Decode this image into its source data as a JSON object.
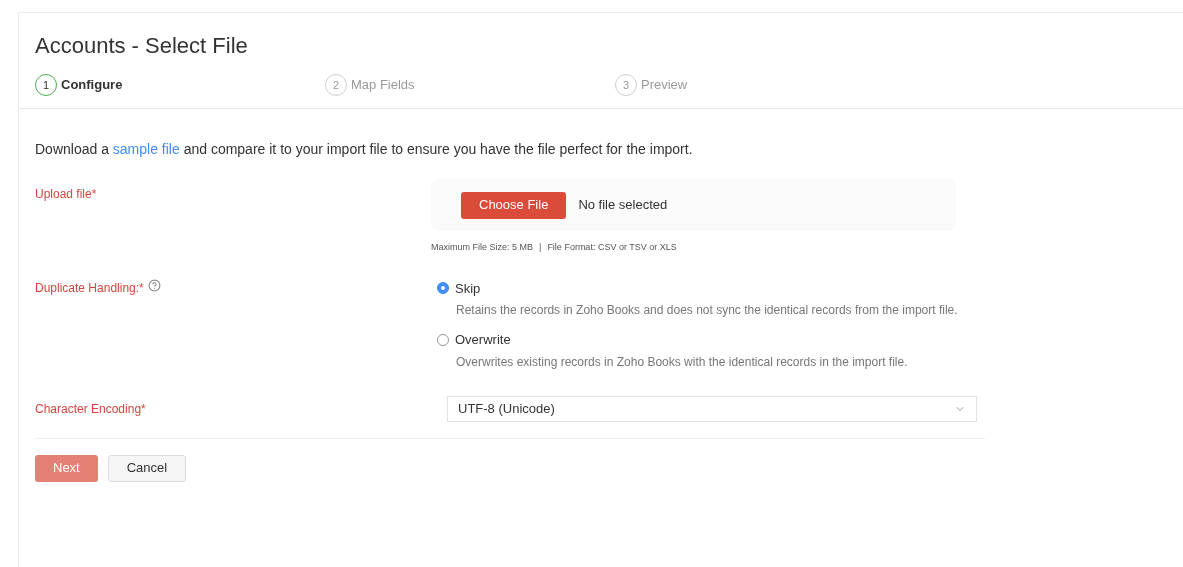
{
  "title": "Accounts - Select File",
  "steps": [
    {
      "number": "1",
      "label": "Configure",
      "selected": true
    },
    {
      "number": "2",
      "label": "Map Fields",
      "selected": false
    },
    {
      "number": "3",
      "label": "Preview",
      "selected": false
    }
  ],
  "intro": {
    "before": "Download a ",
    "link": "sample file",
    "after": " and compare it to your import file to ensure you have the file perfect for the import."
  },
  "upload": {
    "label": "Upload file*",
    "button": "Choose File",
    "status": "No file selected",
    "hint_size": "Maximum File Size: 5 MB",
    "separator": "|",
    "hint_format": "File Format: CSV or TSV or XLS"
  },
  "duplicate": {
    "label": "Duplicate Handling:*",
    "options": [
      {
        "label": "Skip",
        "description": "Retains the records in Zoho Books and does not sync the identical records from the import file.",
        "selected": true
      },
      {
        "label": "Overwrite",
        "description": "Overwrites existing records in Zoho Books with the identical records in the import file.",
        "selected": false
      }
    ]
  },
  "encoding": {
    "label": "Character Encoding*",
    "value": "UTF-8 (Unicode)"
  },
  "buttons": [
    {
      "label": "Next",
      "kind": "primary",
      "disabled": true
    },
    {
      "label": "Cancel",
      "kind": "secondary",
      "disabled": false
    }
  ]
}
